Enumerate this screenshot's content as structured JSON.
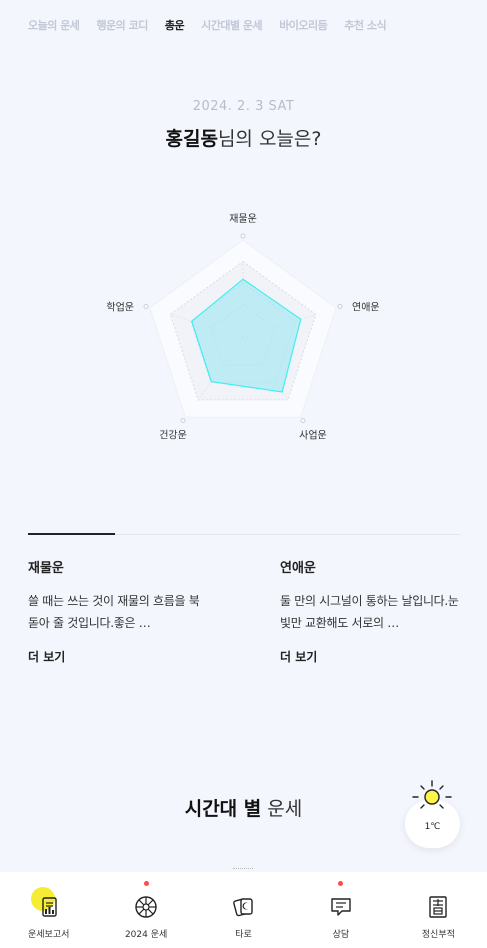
{
  "tabs": [
    "오늘의 운세",
    "행운의 코디",
    "총운",
    "시간대별 운세",
    "바이오리듬",
    "추천 소식"
  ],
  "active_tab": "총운",
  "date": "2024. 2. 3  SAT",
  "headline": {
    "name": "홍길동",
    "suffix": "님의 오늘은?"
  },
  "radar": {
    "axes": [
      "재물운",
      "연애운",
      "사업운",
      "건강운",
      "학업운"
    ],
    "values": [
      0.6,
      0.62,
      0.68,
      0.55,
      0.55
    ],
    "fill_color": "#9ee8f2",
    "stroke_color": "#3ef0ee"
  },
  "cards": [
    {
      "title": "재물운",
      "text": "쓸 때는 쓰는 것이 재물의 흐름을 북돋아 줄 것입니다.좋은 …",
      "more": "더 보기"
    },
    {
      "title": "연애운",
      "text": "둘 만의 시그널이 통하는 날입니다.눈빛만 교환해도 서로의 …",
      "more": "더 보기"
    }
  ],
  "section": {
    "bold": "시간대 별",
    "rest": " 운세"
  },
  "weather": {
    "temp": "1℃",
    "icon": "sun-icon"
  },
  "nav": [
    {
      "label": "운세보고서",
      "icon": "report-icon",
      "dot": false
    },
    {
      "label": "2024 운세",
      "icon": "wheel-icon",
      "dot": true
    },
    {
      "label": "타로",
      "icon": "tarot-icon",
      "dot": false
    },
    {
      "label": "상담",
      "icon": "chat-icon",
      "dot": true
    },
    {
      "label": "정신부적",
      "icon": "talisman-icon",
      "dot": false
    }
  ],
  "colors": {
    "accent_yellow": "#fff34a",
    "background": "#f3f6fd",
    "notification": "#ff4a4a"
  }
}
